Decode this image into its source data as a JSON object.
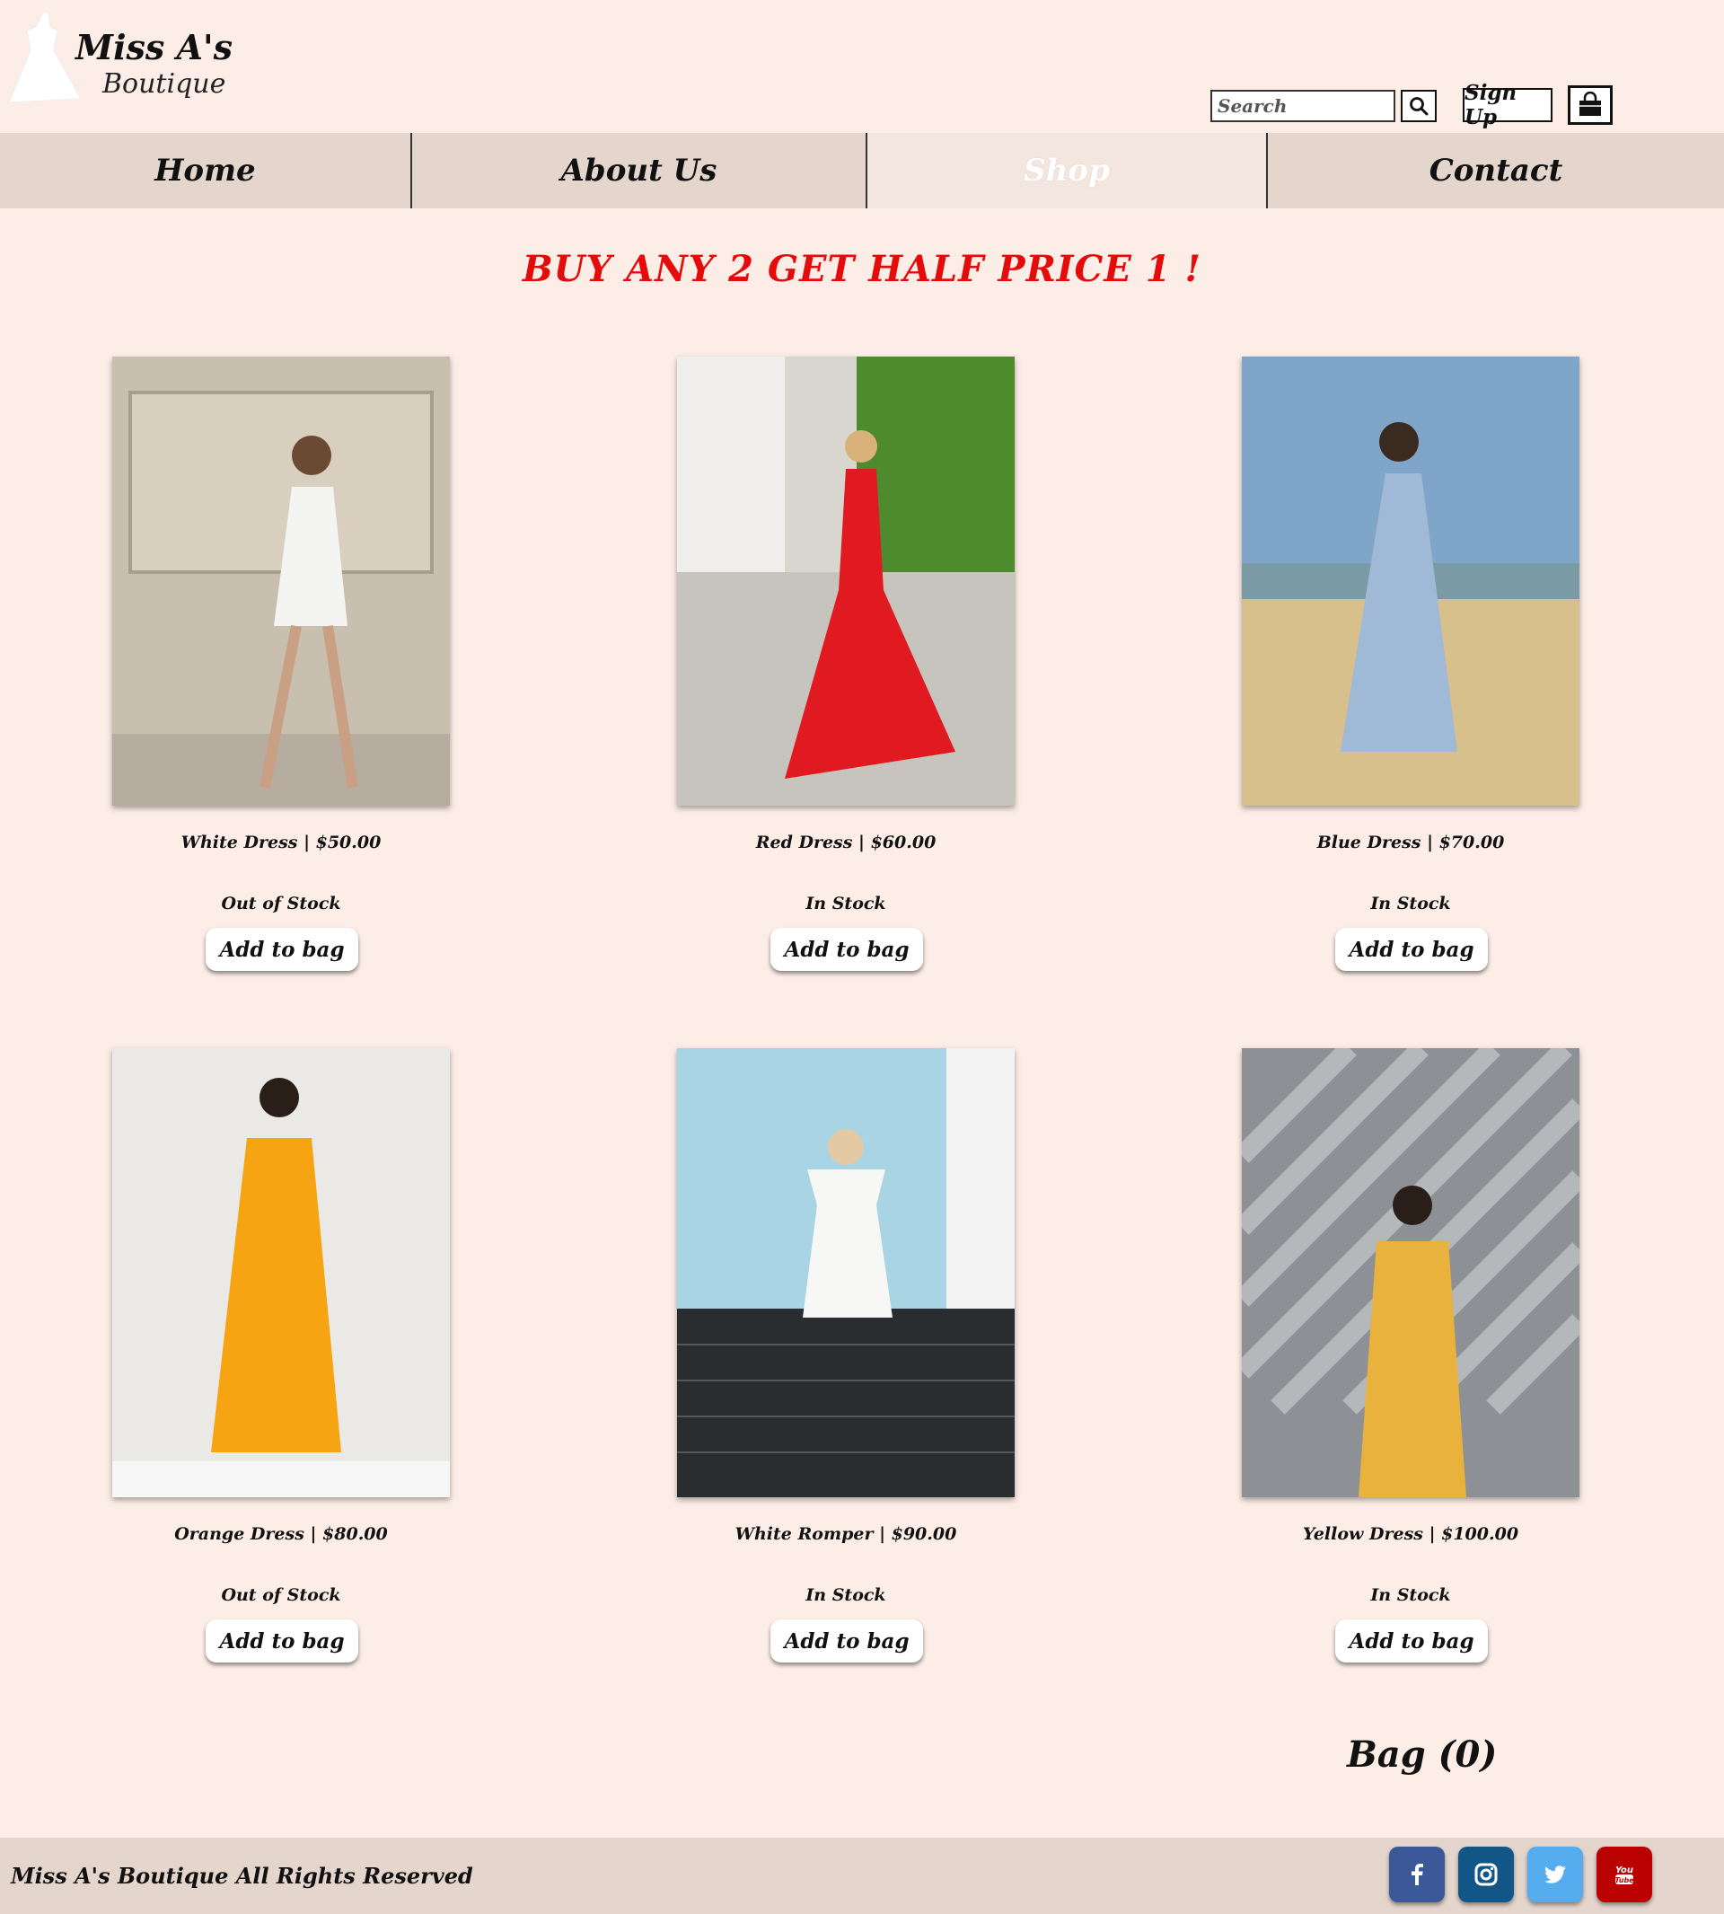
{
  "header": {
    "logo_title": "Miss A's",
    "logo_subtitle": "Boutique",
    "search_placeholder": "Search",
    "signup_label": "Sign Up"
  },
  "nav": {
    "items": [
      {
        "label": "Home",
        "active": false
      },
      {
        "label": "About Us",
        "active": false
      },
      {
        "label": "Shop",
        "active": true
      },
      {
        "label": "Contact",
        "active": false
      }
    ]
  },
  "promo": "BUY ANY 2 GET HALF PRICE 1 !",
  "products": [
    {
      "name_price": "White Dress | $50.00",
      "stock": "Out of Stock",
      "button": "Add to bag",
      "dress_color": "#f4f4f2"
    },
    {
      "name_price": "Red Dress | $60.00",
      "stock": "In Stock",
      "button": "Add to bag",
      "dress_color": "#e11a22"
    },
    {
      "name_price": "Blue Dress | $70.00",
      "stock": "In Stock",
      "button": "Add to bag",
      "dress_color": "#9fb9d6"
    },
    {
      "name_price": "Orange Dress | $80.00",
      "stock": "Out of Stock",
      "button": "Add to bag",
      "dress_color": "#f6a411"
    },
    {
      "name_price": "White Romper | $90.00",
      "stock": "In Stock",
      "button": "Add to bag",
      "dress_color": "#f7f7f5"
    },
    {
      "name_price": "Yellow Dress | $100.00",
      "stock": "In Stock",
      "button": "Add to bag",
      "dress_color": "#e8b23c"
    }
  ],
  "bag": "Bag (0)",
  "footer": {
    "text": "Miss A's Boutique All Rights Reserved",
    "social": [
      {
        "icon": "facebook-icon",
        "color": "#3b5998"
      },
      {
        "icon": "instagram-icon",
        "color": "#125688"
      },
      {
        "icon": "twitter-icon",
        "color": "#55acee"
      },
      {
        "icon": "youtube-icon",
        "color": "#bb0000"
      }
    ]
  }
}
